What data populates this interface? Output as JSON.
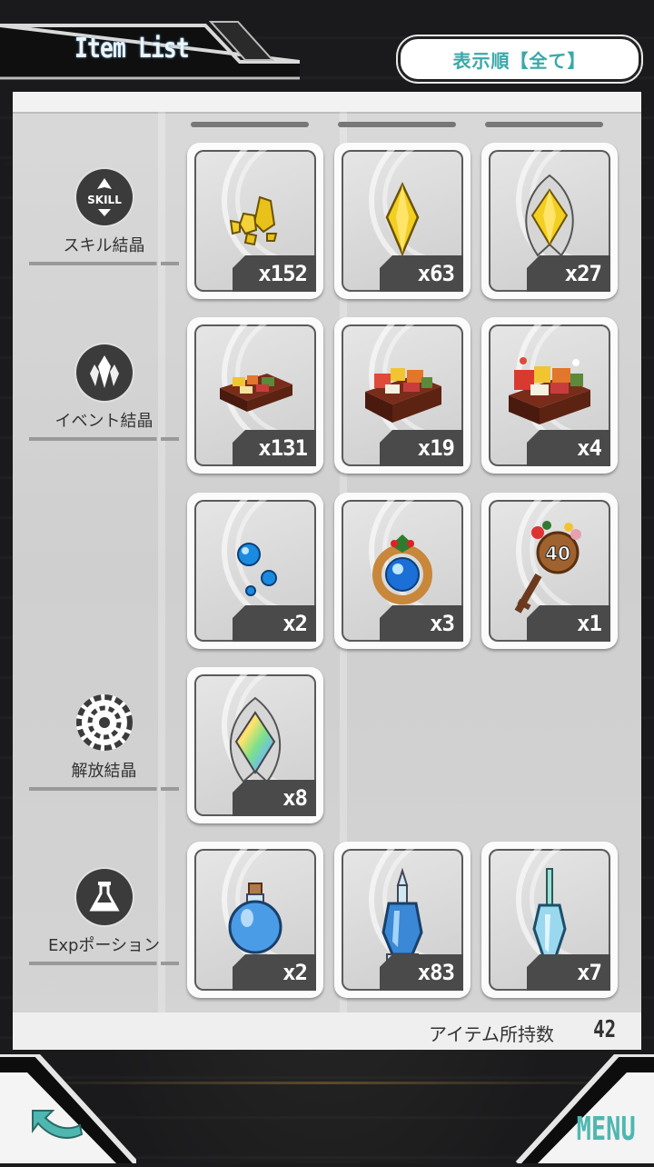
{
  "header": {
    "title": "Item List",
    "sort_label": "表示順【全て】"
  },
  "categories": [
    {
      "label": "スキル結晶",
      "icon": "skill-icon",
      "icon_text": "SKILL"
    },
    {
      "label": "イベント結晶",
      "icon": "crystal-icon"
    },
    {
      "label": "解放結晶",
      "icon": "burst-icon"
    },
    {
      "label": "Expポーション",
      "icon": "flask-icon"
    }
  ],
  "items": [
    {
      "icon": "gold-crystal-shards-icon",
      "count": "x152"
    },
    {
      "icon": "gold-crystal-gem-icon",
      "count": "x63"
    },
    {
      "icon": "gold-crystal-framed-icon",
      "count": "x27"
    },
    {
      "icon": "bento-box-small-icon",
      "count": "x131"
    },
    {
      "icon": "bento-box-medium-icon",
      "count": "x19"
    },
    {
      "icon": "bento-box-large-icon",
      "count": "x4"
    },
    {
      "icon": "blue-bubbles-icon",
      "count": "x2"
    },
    {
      "icon": "new-year-ornament-icon",
      "count": "x3"
    },
    {
      "icon": "anniversary-key-icon",
      "count": "x1"
    },
    {
      "icon": "rainbow-crystal-icon",
      "count": "x8"
    },
    {
      "icon": "round-potion-icon",
      "count": "x2"
    },
    {
      "icon": "tall-potion-icon",
      "count": "x83"
    },
    {
      "icon": "slim-potion-icon",
      "count": "x7"
    }
  ],
  "footer": {
    "held_label": "アイテム所持数",
    "held_value": "42"
  },
  "nav": {
    "menu_label": "MENU"
  },
  "colors": {
    "accent": "#4fb7b0",
    "panel": "#d4d4d4",
    "count_bg": "#4a4a4a"
  }
}
